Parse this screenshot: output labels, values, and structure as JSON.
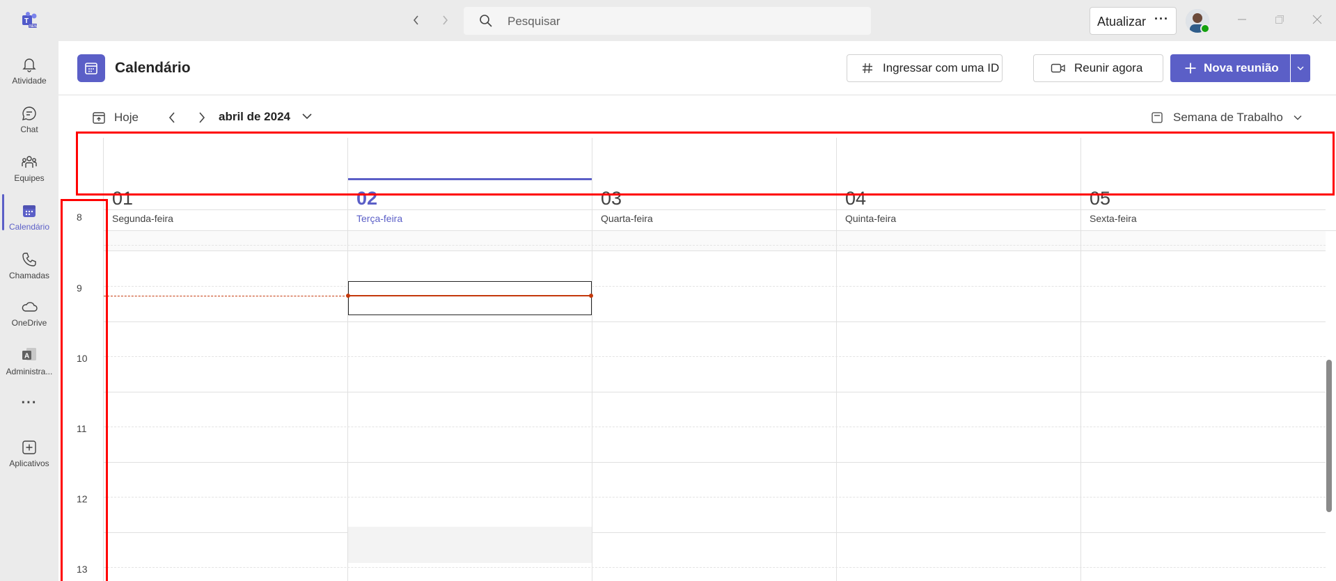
{
  "titlebar": {
    "search_placeholder": "Pesquisar",
    "update_label": "Atualizar",
    "more_label": "···"
  },
  "rail": {
    "items": [
      {
        "label": "Atividade",
        "icon": "bell-icon"
      },
      {
        "label": "Chat",
        "icon": "chat-icon"
      },
      {
        "label": "Equipes",
        "icon": "teams-icon"
      },
      {
        "label": "Calendário",
        "icon": "calendar-icon",
        "active": true
      },
      {
        "label": "Chamadas",
        "icon": "phone-icon"
      },
      {
        "label": "OneDrive",
        "icon": "cloud-icon"
      },
      {
        "label": "Administra...",
        "icon": "admin-app-icon"
      },
      {
        "label": "···",
        "icon": "more-icon"
      },
      {
        "label": "Aplicativos",
        "icon": "add-apps-icon"
      }
    ]
  },
  "header": {
    "title": "Calendário",
    "join_id_label": "Ingressar com uma ID",
    "meet_now_label": "Reunir agora",
    "new_meeting_label": "Nova reunião"
  },
  "toolbar": {
    "today_label": "Hoje",
    "month_label": "abril de 2024",
    "view_label": "Semana de Trabalho"
  },
  "days": [
    {
      "num": "01",
      "name": "Segunda-feira",
      "today": false
    },
    {
      "num": "02",
      "name": "Terça-feira",
      "today": true
    },
    {
      "num": "03",
      "name": "Quarta-feira",
      "today": false
    },
    {
      "num": "04",
      "name": "Quinta-feira",
      "today": false
    },
    {
      "num": "05",
      "name": "Sexta-feira",
      "today": false
    }
  ],
  "hours": [
    "8",
    "9",
    "10",
    "11",
    "12",
    "13"
  ],
  "colors": {
    "accent": "#5b5fc7",
    "current_time": "#c4380b",
    "highlight": "#ff0000"
  }
}
